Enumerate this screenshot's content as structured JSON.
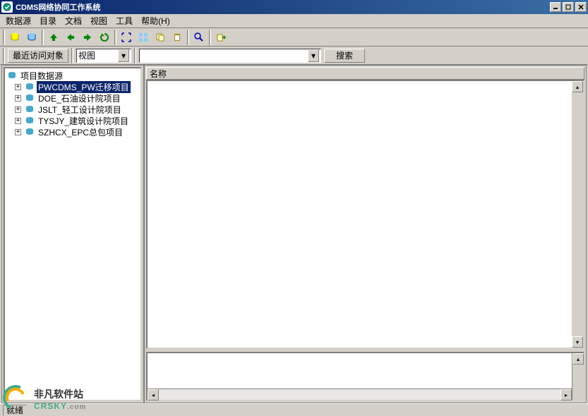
{
  "window": {
    "title": "CDMS网络协同工作系统"
  },
  "menu": {
    "items": [
      "数据源",
      "目录",
      "文档",
      "视图",
      "工具",
      "帮助(H)"
    ]
  },
  "toolbar2": {
    "recent_label": "最近访问对象",
    "view_combo": "视图",
    "search_placeholder": "",
    "search_button": "搜索"
  },
  "tree": {
    "root_label": "项目数据源",
    "items": [
      "PWCDMS_PW迁移项目",
      "DOE_石油设计院项目",
      "JSLT_轻工设计院项目",
      "TYSJY_建筑设计院项目",
      "SZHCX_EPC总包项目"
    ]
  },
  "content": {
    "column_header": "名称"
  },
  "status": {
    "text": "就绪"
  },
  "watermark": {
    "cn": "非凡软件站",
    "en": "CRSKY",
    "suffix": ".com"
  }
}
